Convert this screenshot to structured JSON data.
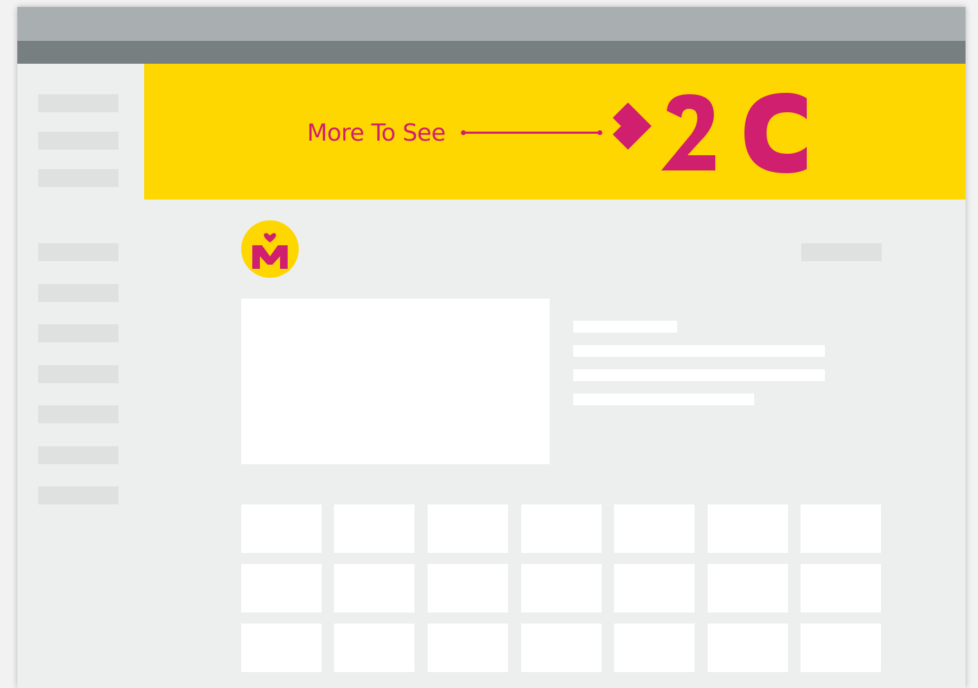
{
  "app": {
    "title_bar": "",
    "toolbar": ""
  },
  "colors": {
    "banner_background": "#fed600",
    "banner_accent": "#d01f6e",
    "window_background": "#ecefee",
    "placeholder_gray": "#dfe1e0"
  },
  "banner": {
    "text": "More To See",
    "logo_text": "2 C",
    "logo_icon": "chevron-right-icon"
  },
  "channel": {
    "avatar_icon": "m-heart-logo-icon"
  },
  "sidebar": {
    "items": [
      {
        "label": ""
      },
      {
        "label": ""
      },
      {
        "label": ""
      },
      {
        "label": ""
      },
      {
        "label": ""
      },
      {
        "label": ""
      },
      {
        "label": ""
      },
      {
        "label": ""
      },
      {
        "label": ""
      },
      {
        "label": ""
      }
    ]
  },
  "grid": {
    "rows": 3,
    "columns": 7
  }
}
